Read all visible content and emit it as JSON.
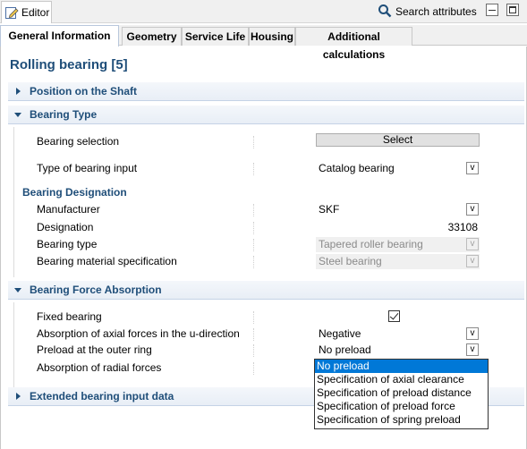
{
  "view": {
    "tab_label": "Editor",
    "search_label": "Search attributes"
  },
  "tabs": [
    {
      "label": "General Information"
    },
    {
      "label": "Geometry"
    },
    {
      "label": "Service Life"
    },
    {
      "label": "Housing"
    },
    {
      "label": "Additional calculations"
    }
  ],
  "page_title": "Rolling bearing [5]",
  "sections": {
    "position": {
      "label": "Position on the Shaft"
    },
    "bearing_type": {
      "label": "Bearing Type",
      "bearing_selection_label": "Bearing selection",
      "select_button": "Select",
      "input_type_label": "Type of bearing input",
      "input_type_value": "Catalog bearing",
      "designation_header": "Bearing Designation",
      "manufacturer_label": "Manufacturer",
      "manufacturer_value": "SKF",
      "designation_label": "Designation",
      "designation_value": "33108",
      "type_label": "Bearing type",
      "type_value": "Tapered roller bearing",
      "material_label": "Bearing material specification",
      "material_value": "Steel bearing"
    },
    "force_absorption": {
      "label": "Bearing Force Absorption",
      "fixed_label": "Fixed bearing",
      "fixed_checked": true,
      "axial_label": "Absorption of axial forces in the u-direction",
      "axial_value": "Negative",
      "preload_label": "Preload at the outer ring",
      "preload_value": "No preload",
      "radial_label": "Absorption of radial forces"
    },
    "extended": {
      "label": "Extended bearing input data"
    }
  },
  "dropdown_glyph": "v",
  "preload_options": [
    "No preload",
    "Specification of axial clearance",
    "Specification of preload distance",
    "Specification of preload force",
    "Specification of spring preload"
  ],
  "colors": {
    "header_text": "#1f4e79",
    "selection": "#0078d7"
  }
}
